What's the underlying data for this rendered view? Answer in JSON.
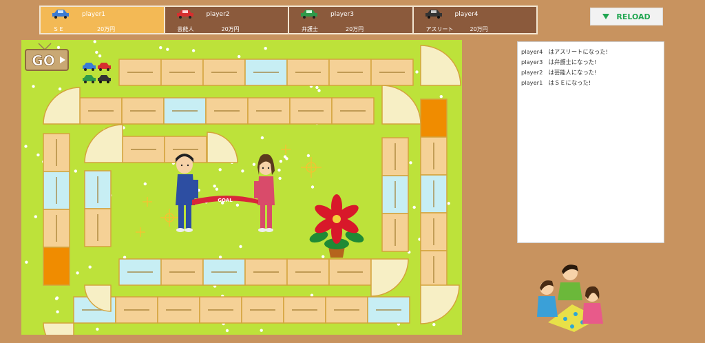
{
  "players": [
    {
      "name": "player1",
      "job": "ＳＥ",
      "money": "20万円",
      "car_color": "#3a7bd5",
      "active": true
    },
    {
      "name": "player2",
      "job": "芸能人",
      "money": "20万円",
      "car_color": "#d62f2f",
      "active": false
    },
    {
      "name": "player3",
      "job": "弁護士",
      "money": "20万円",
      "car_color": "#2e9a4a",
      "active": false
    },
    {
      "name": "player4",
      "job": "アスリート",
      "money": "20万円",
      "car_color": "#333333",
      "active": false
    }
  ],
  "reload_label": "RELOAD",
  "start_sign": "GO",
  "goal_tape": "GOAL",
  "log": [
    "player4　はアスリートになった!",
    "player3　は弁護士になった!",
    "player2　は芸能人になった!",
    "player1　はＳＥになった!"
  ],
  "colors": {
    "background": "#c8935f",
    "panel_active": "#f3b955",
    "panel": "#8b5a3c",
    "reload_text": "#22a652",
    "grass": "#bde23a",
    "tile": "#f5d196",
    "tile_blue": "#c7eef4",
    "tile_orange": "#f08c00"
  }
}
